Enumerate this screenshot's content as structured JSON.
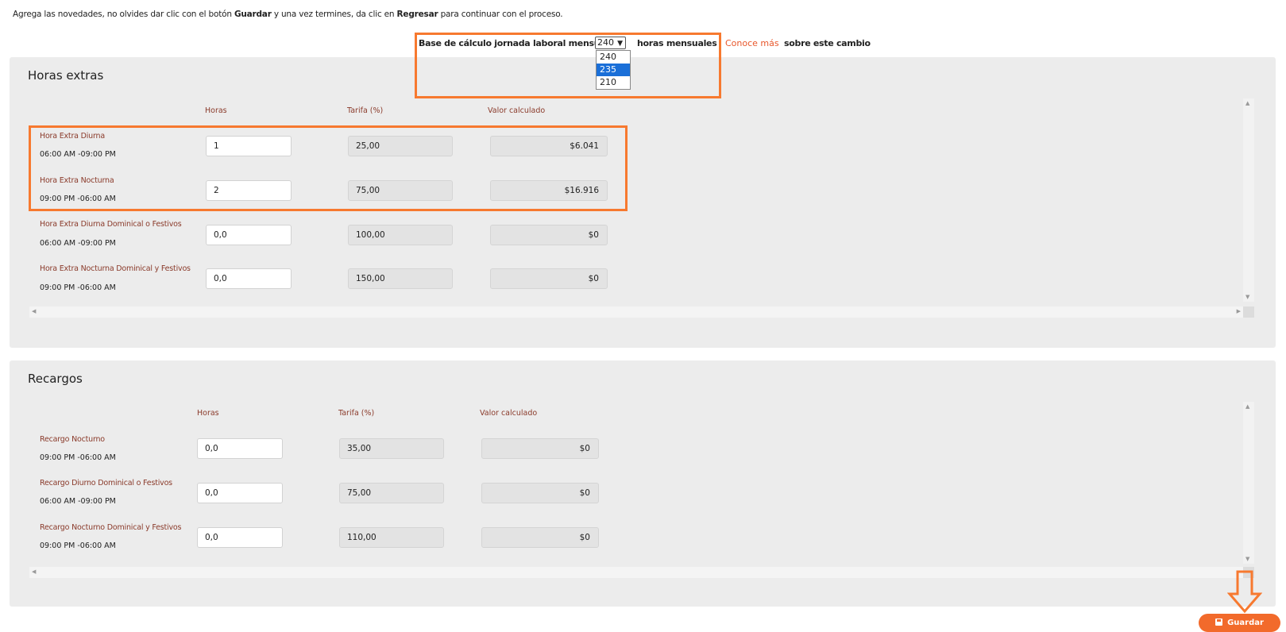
{
  "instructions": {
    "part1": "Agrega las novedades, no olvides dar clic con el botón ",
    "bold1": "Guardar",
    "part2": " y una vez termines, da clic en ",
    "bold2": "Regresar",
    "part3": " para continuar con el proceso."
  },
  "base": {
    "label": "Base de cálculo jornada laboral mensual",
    "selected": "240",
    "options": [
      "240",
      "235",
      "210"
    ],
    "highlighted_option": "235",
    "units": "horas mensuales",
    "link": "Conoce más",
    "after_link": "sobre este cambio"
  },
  "horas_extras": {
    "title": "Horas extras",
    "columns": {
      "horas": "Horas",
      "tarifa": "Tarifa (%)",
      "valor": "Valor calculado"
    },
    "rows": [
      {
        "name": "Hora Extra Diurna",
        "time": "06:00 AM -09:00 PM",
        "horas": "1",
        "tarifa": "25,00",
        "valor": "$6.041"
      },
      {
        "name": "Hora Extra Nocturna",
        "time": "09:00 PM -06:00 AM",
        "horas": "2",
        "tarifa": "75,00",
        "valor": "$16.916"
      },
      {
        "name": "Hora Extra Diurna Dominical o Festivos",
        "time": "06:00 AM -09:00 PM",
        "horas": "0,0",
        "tarifa": "100,00",
        "valor": "$0"
      },
      {
        "name": "Hora Extra Nocturna Dominical y Festivos",
        "time": "09:00 PM -06:00 AM",
        "horas": "0,0",
        "tarifa": "150,00",
        "valor": "$0"
      }
    ]
  },
  "recargos": {
    "title": "Recargos",
    "columns": {
      "horas": "Horas",
      "tarifa": "Tarifa (%)",
      "valor": "Valor calculado"
    },
    "rows": [
      {
        "name": "Recargo Nocturno",
        "time": "09:00 PM -06:00 AM",
        "horas": "0,0",
        "tarifa": "35,00",
        "valor": "$0"
      },
      {
        "name": "Recargo Diurno Dominical o Festivos",
        "time": "06:00 AM -09:00 PM",
        "horas": "0,0",
        "tarifa": "75,00",
        "valor": "$0"
      },
      {
        "name": "Recargo Nocturno Dominical y Festivos",
        "time": "09:00 PM -06:00 AM",
        "horas": "0,0",
        "tarifa": "110,00",
        "valor": "$0"
      }
    ]
  },
  "save_button": {
    "label": "Guardar",
    "icon": "save-icon"
  },
  "colors": {
    "accent": "#f26a2b",
    "annotation": "#f7792f",
    "row_label": "#8a3a2a",
    "panel_bg": "#ececec",
    "dropdown_highlight": "#1a6fd8"
  }
}
